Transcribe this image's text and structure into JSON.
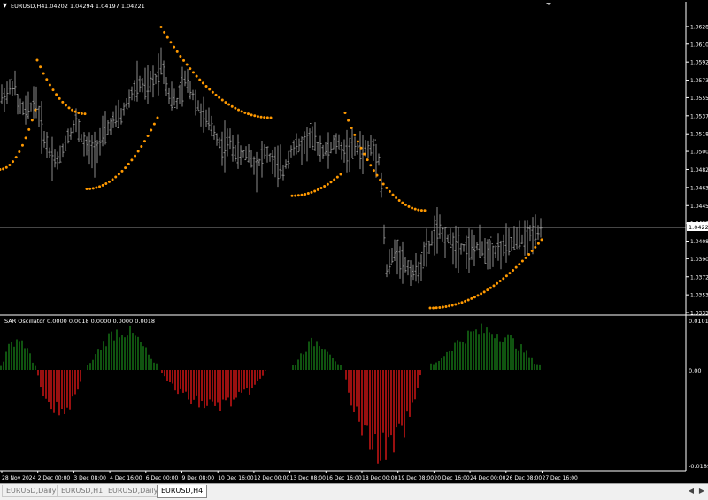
{
  "window": {
    "title": "EURUSD,H4",
    "ohlc": "1.04202 1.04294 1.04197 1.04221"
  },
  "colors": {
    "background": "#000000",
    "bar": "#8c8c8c",
    "sar": "#ff9900",
    "osc_up": "#1c8c1c",
    "osc_down": "#ff1a1a",
    "axis": "#ffffff",
    "price_line": "#8c8c8c"
  },
  "price_axis": [
    "1.06285",
    "1.06105",
    "1.05920",
    "1.05735",
    "1.05555",
    "1.05370",
    "1.05185",
    "1.05005",
    "1.04820",
    "1.04635",
    "1.04450",
    "1.04270",
    "1.04085",
    "1.03905",
    "1.03720",
    "1.03535",
    "1.03355"
  ],
  "current_price": "1.04221",
  "oscillator": {
    "label": "SAR Oscillator 0.0000 0.0018 0.0000 0.0000 0.0018",
    "axis": [
      "0.0101",
      "0.00",
      "-0.0189"
    ]
  },
  "time_axis": [
    "28 Nov 2024",
    "2 Dec 00:00",
    "3 Dec 08:00",
    "4 Dec 16:00",
    "6 Dec 00:00",
    "9 Dec 08:00",
    "10 Dec 16:00",
    "12 Dec 00:00",
    "13 Dec 08:00",
    "16 Dec 16:00",
    "18 Dec 00:00",
    "19 Dec 08:00",
    "20 Dec 16:00",
    "24 Dec 00:00",
    "26 Dec 08:00",
    "27 Dec 16:00"
  ],
  "tabs": [
    "EURUSD,Daily",
    "EURUSD,H1",
    "EURUSD,Daily",
    "EURUSD,H4"
  ],
  "chart_data": {
    "type": "bar",
    "symbol": "EURUSD",
    "timeframe": "H4",
    "ylim": [
      1.03355,
      1.06375
    ],
    "price_path": [
      [
        0,
        1.0555
      ],
      [
        8,
        1.056
      ],
      [
        16,
        1.0572
      ],
      [
        20,
        1.0548
      ],
      [
        30,
        1.054
      ],
      [
        40,
        1.0555
      ],
      [
        48,
        1.052
      ],
      [
        56,
        1.05
      ],
      [
        66,
        1.049
      ],
      [
        76,
        1.0515
      ],
      [
        86,
        1.053
      ],
      [
        96,
        1.0505
      ],
      [
        106,
        1.05
      ],
      [
        116,
        1.0515
      ],
      [
        126,
        1.053
      ],
      [
        136,
        1.0535
      ],
      [
        146,
        1.0555
      ],
      [
        156,
        1.057
      ],
      [
        166,
        1.0565
      ],
      [
        176,
        1.0575
      ],
      [
        183,
        1.0595
      ],
      [
        190,
        1.056
      ],
      [
        200,
        1.055
      ],
      [
        210,
        1.0575
      ],
      [
        220,
        1.0555
      ],
      [
        230,
        1.0535
      ],
      [
        240,
        1.0525
      ],
      [
        250,
        1.0505
      ],
      [
        260,
        1.051
      ],
      [
        270,
        1.0495
      ],
      [
        280,
        1.05
      ],
      [
        290,
        1.0485
      ],
      [
        300,
        1.05
      ],
      [
        310,
        1.0488
      ],
      [
        320,
        1.048
      ],
      [
        330,
        1.0505
      ],
      [
        340,
        1.0505
      ],
      [
        350,
        1.0515
      ],
      [
        360,
        1.0505
      ],
      [
        370,
        1.05
      ],
      [
        380,
        1.051
      ],
      [
        390,
        1.05
      ],
      [
        400,
        1.0505
      ],
      [
        410,
        1.05
      ],
      [
        420,
        1.0505
      ],
      [
        428,
        1.0495
      ],
      [
        432,
        1.0455
      ],
      [
        436,
        1.0375
      ],
      [
        442,
        1.039
      ],
      [
        448,
        1.04
      ],
      [
        456,
        1.0385
      ],
      [
        464,
        1.038
      ],
      [
        470,
        1.0375
      ],
      [
        478,
        1.039
      ],
      [
        486,
        1.0405
      ],
      [
        492,
        1.042
      ],
      [
        500,
        1.0415
      ],
      [
        508,
        1.041
      ],
      [
        516,
        1.0405
      ],
      [
        524,
        1.0402
      ],
      [
        532,
        1.04
      ],
      [
        540,
        1.0402
      ],
      [
        548,
        1.04
      ],
      [
        556,
        1.0398
      ],
      [
        566,
        1.04
      ],
      [
        576,
        1.0405
      ],
      [
        586,
        1.041
      ],
      [
        596,
        1.0412
      ],
      [
        604,
        1.042
      ],
      [
        612,
        1.0422
      ]
    ],
    "sar_segments": [
      {
        "side": "below",
        "points": [
          [
            0,
            1.0482
          ],
          [
            40,
            1.0543
          ]
        ]
      },
      {
        "side": "above",
        "points": [
          [
            42,
            1.0594
          ],
          [
            96,
            1.0539
          ]
        ]
      },
      {
        "side": "below",
        "points": [
          [
            98,
            1.0462
          ],
          [
            178,
            1.0535
          ]
        ]
      },
      {
        "side": "above",
        "points": [
          [
            182,
            1.0628
          ],
          [
            306,
            1.0535
          ]
        ]
      },
      {
        "side": "below",
        "points": [
          [
            330,
            1.0455
          ],
          [
            385,
            1.0477
          ]
        ]
      },
      {
        "side": "above",
        "points": [
          [
            390,
            1.054
          ],
          [
            480,
            1.044
          ]
        ]
      },
      {
        "side": "below",
        "points": [
          [
            486,
            1.034
          ],
          [
            612,
            1.041
          ]
        ]
      }
    ],
    "oscillator_series": [
      {
        "name": "SAR Oscillator",
        "range": [
          -0.0189,
          0.0101
        ],
        "segments": [
          {
            "sign": "positive",
            "range_x": [
              0,
              40
            ],
            "peak": 0.0075
          },
          {
            "sign": "negative",
            "range_x": [
              42,
              96
            ],
            "peak": -0.0095
          },
          {
            "sign": "positive",
            "range_x": [
              98,
              178
            ],
            "peak": 0.0095
          },
          {
            "sign": "negative",
            "range_x": [
              182,
              306
            ],
            "peak": -0.0082
          },
          {
            "sign": "positive",
            "range_x": [
              330,
              385
            ],
            "peak": 0.0068
          },
          {
            "sign": "negative",
            "range_x": [
              390,
              480
            ],
            "peak": -0.0185
          },
          {
            "sign": "positive",
            "range_x": [
              486,
              612
            ],
            "peak": 0.0095
          }
        ]
      }
    ]
  }
}
